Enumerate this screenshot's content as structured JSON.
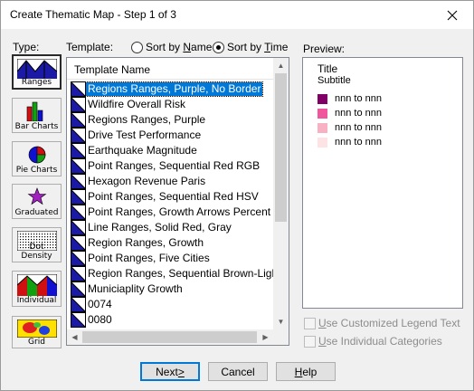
{
  "window": {
    "title": "Create Thematic Map - Step 1 of 3"
  },
  "labels": {
    "type": "Type:",
    "template": "Template:",
    "preview": "Preview:"
  },
  "sort": {
    "by_name_prefix": "Sort by ",
    "by_name_key": "N",
    "by_name_rest": "ame",
    "by_time_prefix": "Sort by ",
    "by_time_key": "T",
    "by_time_rest": "ime",
    "selected": "time"
  },
  "types": [
    {
      "label": "Ranges",
      "icon": "ranges-icon",
      "active": true
    },
    {
      "label": "Bar Charts",
      "icon": "bar-chart-icon",
      "active": false
    },
    {
      "label": "Pie Charts",
      "icon": "pie-chart-icon",
      "active": false
    },
    {
      "label": "Graduated",
      "icon": "graduated-star-icon",
      "active": false
    },
    {
      "label": "Dot Density",
      "icon": "dot-density-icon",
      "active": false
    },
    {
      "label": "Individual",
      "icon": "individual-icon",
      "active": false
    },
    {
      "label": "Grid",
      "icon": "grid-icon",
      "active": false
    }
  ],
  "template_list": {
    "header": "Template Name",
    "items": [
      "Regions Ranges, Purple, No Border",
      "Wildfire Overall Risk",
      "Regions Ranges, Purple",
      "Drive Test Performance",
      "Earthquake Magnitude",
      "Point Ranges, Sequential Red RGB",
      "Hexagon Revenue Paris",
      "Point Ranges, Sequential Red HSV",
      "Point Ranges, Growth Arrows Percent",
      "Line Ranges, Solid Red, Gray",
      "Region Ranges, Growth",
      "Point Ranges, Five Cities",
      "Region Ranges, Sequential Brown-Light Yel",
      "Municiaplity Growth",
      "0074",
      "0080"
    ],
    "selected_index": 0
  },
  "preview": {
    "title": "Title",
    "subtitle": "Subtitle",
    "legend": [
      {
        "label": "nnn to nnn",
        "color": "#800066"
      },
      {
        "label": "nnn to nnn",
        "color": "#f0569e"
      },
      {
        "label": "nnn to nnn",
        "color": "#f7b1c2"
      },
      {
        "label": "nnn to nnn",
        "color": "#fde3e3"
      }
    ]
  },
  "options": {
    "customized_legend_prefix": "U",
    "customized_legend_rest": "se Customized Legend Text",
    "individual_categories_prefix": "U",
    "individual_categories_rest": "se Individual Categories"
  },
  "buttons": {
    "next_prefix": "Next ",
    "next_key": ">",
    "cancel": "Cancel",
    "help_key": "H",
    "help_rest": "elp"
  },
  "colors": {
    "selection": "#0078d7",
    "default_button_border": "#0078d7"
  }
}
